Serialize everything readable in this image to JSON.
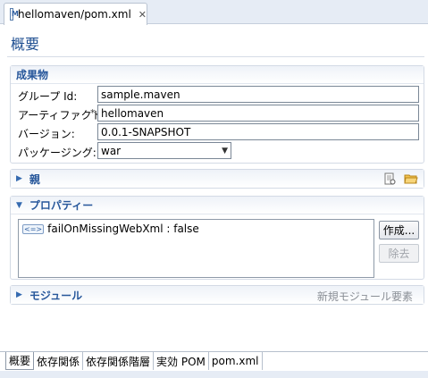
{
  "editor_tab": {
    "icon_letter": "M",
    "label": "hellomaven/pom.xml",
    "close": "✕"
  },
  "page_title": "概要",
  "artifact_section": {
    "title": "成果物",
    "fields": [
      {
        "label": "グループ Id:",
        "value": "sample.maven"
      },
      {
        "label": "アーティファクト Id:",
        "required": "*",
        "value": "hellomaven"
      },
      {
        "label": "バージョン:",
        "value": "0.0.1-SNAPSHOT"
      },
      {
        "label": "パッケージング:",
        "value": "war"
      }
    ]
  },
  "parent_section": {
    "title": "親"
  },
  "properties_section": {
    "title": "プロパティー",
    "items": [
      {
        "text": "failOnMissingWebXml : false"
      }
    ],
    "create_button": "作成...",
    "remove_button": "除去"
  },
  "modules_section": {
    "title": "モジュール",
    "hint": "新規モジュール要素"
  },
  "bottom_tabs": [
    "概要",
    "依存関係",
    "依存関係階層",
    "実効 POM",
    "pom.xml"
  ]
}
